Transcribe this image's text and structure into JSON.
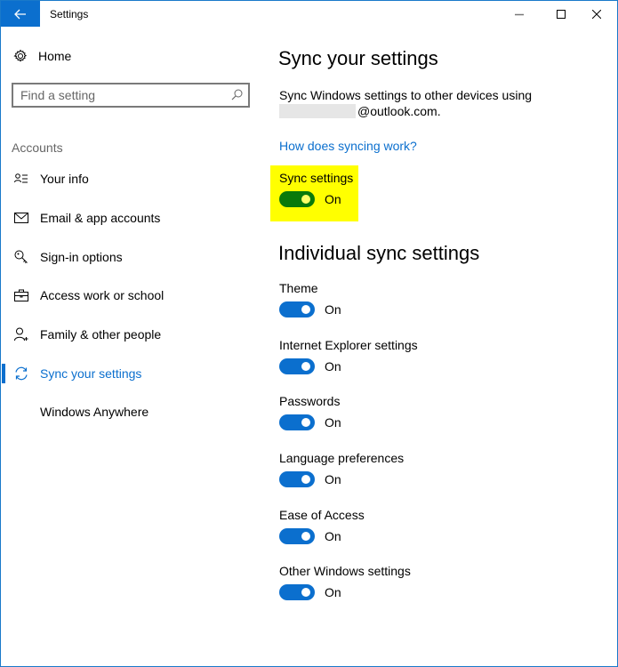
{
  "window": {
    "title": "Settings",
    "back_icon": "back-arrow-icon",
    "controls": [
      "minimize",
      "maximize",
      "close"
    ]
  },
  "sidebar": {
    "home_label": "Home",
    "search_placeholder": "Find a setting",
    "section_label": "Accounts",
    "items": [
      {
        "label": "Your info",
        "icon": "person-list-icon",
        "active": false
      },
      {
        "label": "Email & app accounts",
        "icon": "mail-icon",
        "active": false
      },
      {
        "label": "Sign-in options",
        "icon": "key-icon",
        "active": false
      },
      {
        "label": "Access work or school",
        "icon": "briefcase-icon",
        "active": false
      },
      {
        "label": "Family & other people",
        "icon": "person-add-icon",
        "active": false
      },
      {
        "label": "Sync your settings",
        "icon": "sync-icon",
        "active": true
      },
      {
        "label": "Windows Anywhere",
        "icon": "",
        "active": false
      }
    ]
  },
  "main": {
    "title": "Sync your settings",
    "description_prefix": "Sync Windows settings to other devices using",
    "email_suffix": "@outlook.com.",
    "help_link": "How does syncing work?",
    "sync_settings": {
      "label": "Sync settings",
      "state": "On",
      "highlighted": true
    },
    "individual_title": "Individual sync settings",
    "individual": [
      {
        "label": "Theme",
        "state": "On"
      },
      {
        "label": "Internet Explorer settings",
        "state": "On"
      },
      {
        "label": "Passwords",
        "state": "On"
      },
      {
        "label": "Language preferences",
        "state": "On"
      },
      {
        "label": "Ease of Access",
        "state": "On"
      },
      {
        "label": "Other Windows settings",
        "state": "On"
      }
    ]
  },
  "colors": {
    "accent": "#0b6fce",
    "highlight": "#ffff00",
    "toggle_highlighted": "#0a7a0a",
    "window_border": "#1979ca"
  }
}
